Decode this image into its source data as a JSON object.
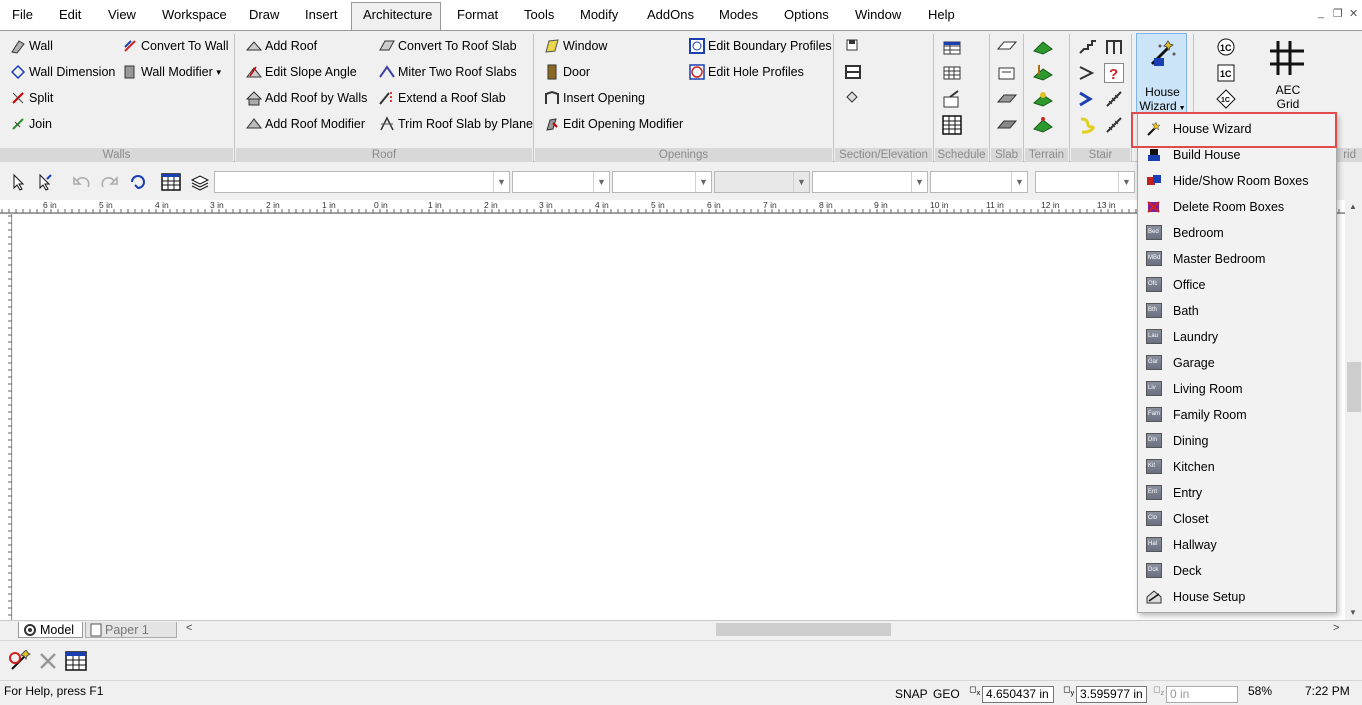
{
  "menu": [
    "File",
    "Edit",
    "View",
    "Workspace",
    "Draw",
    "Insert",
    "Architecture",
    "Format",
    "Tools",
    "Modify",
    "AddOns",
    "Modes",
    "Options",
    "Window",
    "Help"
  ],
  "menu_active": "Architecture",
  "ribbon": {
    "walls": {
      "label": "Walls",
      "items": [
        "Wall",
        "Wall Dimension",
        "Split",
        "Join",
        "Convert To Wall",
        "Wall Modifier"
      ]
    },
    "roof": {
      "label": "Roof",
      "items": [
        "Add Roof",
        "Edit Slope Angle",
        "Add Roof by Walls",
        "Add Roof Modifier",
        "Convert To Roof Slab",
        "Miter Two Roof Slabs",
        "Extend a Roof Slab",
        "Trim Roof Slab by Plane"
      ]
    },
    "openings": {
      "label": "Openings",
      "items": [
        "Window",
        "Door",
        "Insert Opening",
        "Edit Opening Modifier",
        "Edit Boundary Profiles",
        "Edit Hole Profiles"
      ]
    },
    "section": {
      "label": "Section/Elevation"
    },
    "schedule": {
      "label": "Schedule"
    },
    "slab": {
      "label": "Slab"
    },
    "terrain": {
      "label": "Terrain"
    },
    "stair": {
      "label": "Stair"
    },
    "house_wizard": {
      "line1": "House",
      "line2": "Wizard"
    },
    "aec_grid": {
      "line1": "AEC",
      "line2": "Grid",
      "group_suffix": "rid"
    }
  },
  "dropdown": [
    "House Wizard",
    "Build House",
    "Hide/Show Room Boxes",
    "Delete Room Boxes",
    "Bedroom",
    "Master Bedroom",
    "Office",
    "Bath",
    "Laundry",
    "Garage",
    "Living Room",
    "Family Room",
    "Dining",
    "Kitchen",
    "Entry",
    "Closet",
    "Hallway",
    "Deck",
    "House Setup"
  ],
  "room_icon_labels": [
    "Bed",
    "MBd",
    "Ofc",
    "Bth",
    "Lau",
    "Gar",
    "Liv",
    "Fam",
    "Din",
    "Kit",
    "Ent",
    "Clo",
    "Hal",
    "Dck"
  ],
  "ruler": [
    "6 in",
    "5 in",
    "4 in",
    "3 in",
    "2 in",
    "1 in",
    "0 in",
    "1 in",
    "2 in",
    "3 in",
    "4 in",
    "5 in",
    "6 in",
    "7 in",
    "8 in",
    "9 in",
    "10 in",
    "11 in",
    "12 in",
    "13 in"
  ],
  "tabs": {
    "model": "Model",
    "paper": "Paper 1"
  },
  "status": {
    "help": "For Help, press F1",
    "snap": "SNAP",
    "geo": "GEO",
    "x": "4.650437 in",
    "y": "3.595977 in",
    "z": "0 in",
    "zoom": "58%",
    "time": "7:22 PM"
  },
  "colors": {
    "highlight_border": "#e04a4a",
    "wizard_btn_bg": "#cce4f7"
  }
}
